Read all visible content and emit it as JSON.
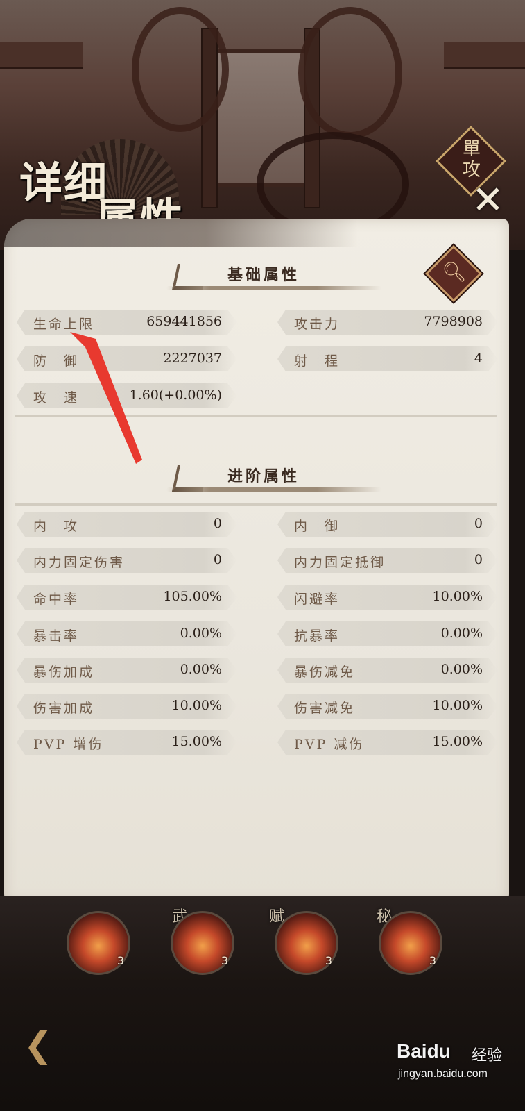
{
  "header": {
    "title_line1": "详细",
    "title_line2": "属性",
    "close_badge_text": "單攻",
    "close_icon": "close-x-icon"
  },
  "basic": {
    "title": "基础属性",
    "search_icon": "magnifier-icon",
    "stats": [
      {
        "label": "生命上限",
        "value": "659441856"
      },
      {
        "label": "攻击力",
        "value": "7798908"
      },
      {
        "label": "防　御",
        "value": "2227037"
      },
      {
        "label": "射　程",
        "value": "4"
      },
      {
        "label": "攻　速",
        "value": "1.60(+0.00%)"
      }
    ]
  },
  "advanced": {
    "title": "进阶属性",
    "stats": [
      {
        "label": "内　攻",
        "value": "0"
      },
      {
        "label": "内　御",
        "value": "0"
      },
      {
        "label": "内力固定伤害",
        "value": "0"
      },
      {
        "label": "内力固定抵御",
        "value": "0"
      },
      {
        "label": "命中率",
        "value": "105.00%"
      },
      {
        "label": "闪避率",
        "value": "10.00%"
      },
      {
        "label": "暴击率",
        "value": "0.00%"
      },
      {
        "label": "抗暴率",
        "value": "0.00%"
      },
      {
        "label": "暴伤加成",
        "value": "0.00%"
      },
      {
        "label": "暴伤减免",
        "value": "0.00%"
      },
      {
        "label": "伤害加成",
        "value": "10.00%"
      },
      {
        "label": "伤害减免",
        "value": "10.00%"
      },
      {
        "label": "PVP 增伤",
        "value": "15.00%"
      },
      {
        "label": "PVP 减伤",
        "value": "15.00%"
      }
    ]
  },
  "skills": {
    "tags": [
      "武",
      "赋",
      "秘"
    ],
    "levels": [
      "3",
      "3",
      "3",
      "3"
    ]
  },
  "watermark": {
    "brand": "Baidu",
    "label": "经验",
    "site": "jingyan.baidu.com"
  },
  "colors": {
    "annotation_arrow": "#e8392f",
    "parchment": "#ebe7de",
    "accent_gold": "#c89a68"
  }
}
